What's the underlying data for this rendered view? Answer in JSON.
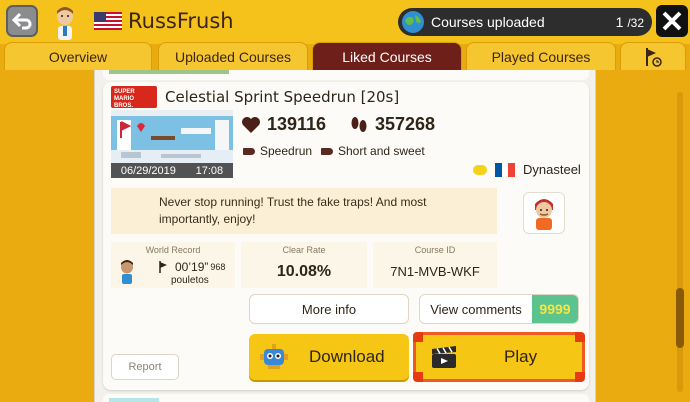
{
  "header": {
    "username": "RussFrush",
    "uploaded_label": "Courses uploaded",
    "uploaded_current": "1",
    "uploaded_total": "/32"
  },
  "tabs": [
    {
      "label": "Overview"
    },
    {
      "label": "Uploaded Courses"
    },
    {
      "label": "Liked Courses"
    },
    {
      "label": "Played Courses"
    }
  ],
  "active_tab": "Liked Courses",
  "course": {
    "game_logo": "SUPER MARIO BROS.",
    "title": "Celestial Sprint Speedrun [20s]",
    "likes": "139116",
    "plays": "357268",
    "tags": [
      "Speedrun",
      "Short and sweet"
    ],
    "maker": "Dynasteel",
    "upload_date": "06/29/2019",
    "upload_time": "17:08",
    "description": "Never stop running! Trust the fake traps! And most importantly, enjoy!",
    "world_record_label": "World Record",
    "world_record_time": "00’19”",
    "world_record_ms": "968",
    "world_record_holder": "pouletos",
    "clear_rate_label": "Clear Rate",
    "clear_rate": "10.08%",
    "course_id_label": "Course ID",
    "course_id": "7N1-MVB-WKF",
    "comment_count": "9999"
  },
  "buttons": {
    "more_info": "More info",
    "view_comments": "View comments",
    "download": "Download",
    "play": "Play",
    "report": "Report"
  },
  "colors": {
    "accent_yellow": "#f6c614",
    "active_tab": "#6e1f1a",
    "play_border": "#f05a22",
    "comment_badge": "#5bc38d"
  },
  "icons": {
    "back": "back-arrow-icon",
    "close": "close-x-icon",
    "globe": "globe-icon",
    "flag_goal": "goal-flag-icon",
    "heart": "heart-icon",
    "footprints": "footprints-icon",
    "tag": "tag-icon",
    "download": "robot-download-icon",
    "play": "clapperboard-icon"
  }
}
